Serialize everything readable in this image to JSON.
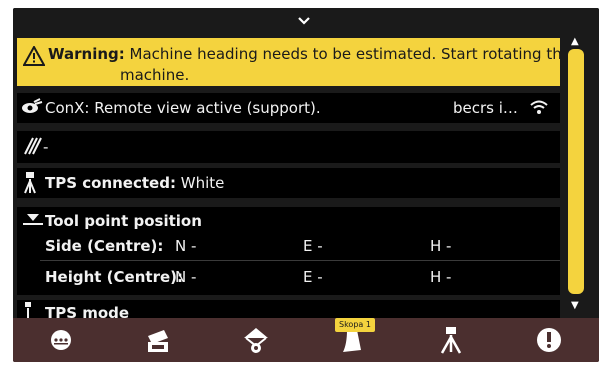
{
  "warning": {
    "label": "Warning:",
    "line1": "Machine heading needs to be estimated. Start rotating the",
    "line2": "machine."
  },
  "remote": {
    "text": "ConX: Remote view active (support).",
    "status": "becrs i…"
  },
  "blank_row": {
    "text": "-"
  },
  "tps": {
    "label": "TPS connected:",
    "value": "White"
  },
  "tool": {
    "title": "Tool point position",
    "rows": [
      {
        "label": "Side (Centre):",
        "n": "N -",
        "e": "E -",
        "h": "H -"
      },
      {
        "label": "Height (Centre):",
        "n": "N -",
        "e": "E -",
        "h": "H -"
      }
    ]
  },
  "mode": {
    "label": "TPS mode"
  },
  "bottombar": {
    "tooltip": "Skopa 1",
    "items": [
      "menu-icon",
      "camera-layer-icon",
      "machine-view-icon",
      "bucket-icon",
      "tripod-icon",
      "alert-icon"
    ]
  },
  "colors": {
    "accent": "#f4d33e",
    "bar": "#4b2f2f",
    "bg": "#000000"
  }
}
